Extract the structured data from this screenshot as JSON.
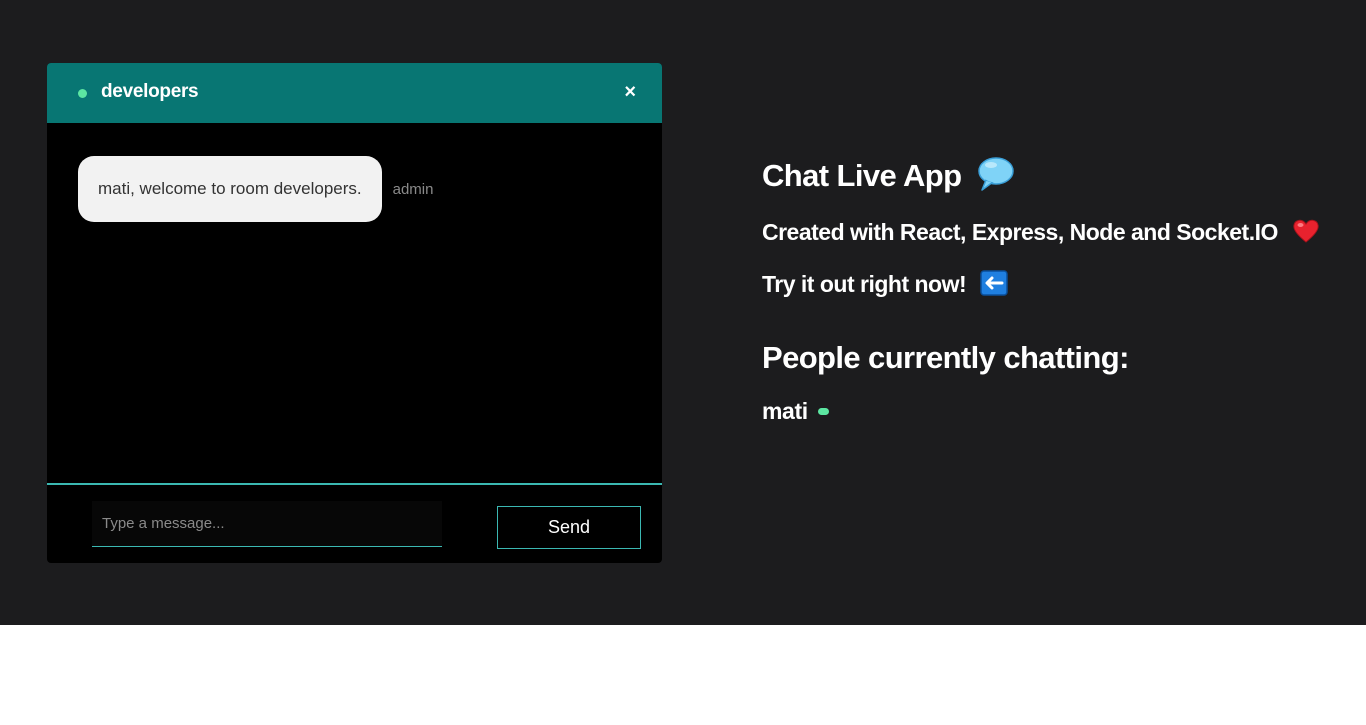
{
  "chat": {
    "room_name": "developers",
    "close_label": "×",
    "messages": [
      {
        "text": "mati, welcome to room developers.",
        "sender": "admin"
      }
    ],
    "input_placeholder": "Type a message...",
    "send_label": "Send"
  },
  "info": {
    "title": "Chat Live App",
    "title_icon": "speech-bubble-icon",
    "line1": "Created with React, Express, Node and Socket.IO",
    "line1_icon": "heart-icon",
    "line2": "Try it out right now!",
    "line2_icon": "left-arrow-icon",
    "people_heading": "People currently chatting:",
    "users": [
      {
        "name": "mati",
        "status_icon": "online-dot-icon"
      }
    ]
  },
  "colors": {
    "background": "#1c1c1e",
    "header": "#087673",
    "accent": "#3bb8b2",
    "online": "#5ce6a2",
    "bubble": "#f2f2f2"
  }
}
